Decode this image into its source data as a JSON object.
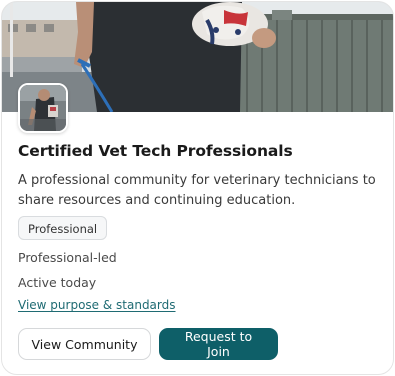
{
  "card": {
    "title": "Certified Vet Tech Professionals",
    "description": "A professional community for veterinary technicians to share resources and continuing education.",
    "tag": "Professional",
    "leadership": "Professional-led",
    "activity": "Active today",
    "purpose_link": "View purpose & standards",
    "view_button": "View Community",
    "join_button": "Request to Join"
  },
  "colors": {
    "accent": "#0e5f68",
    "link": "#1f6b73"
  }
}
